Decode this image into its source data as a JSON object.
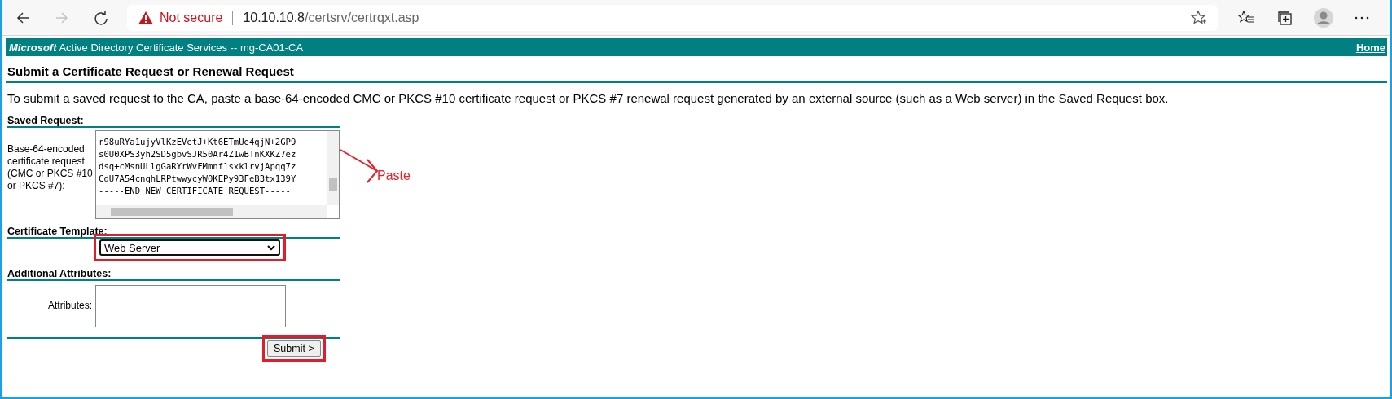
{
  "browser": {
    "security": "Not secure",
    "url_host": "10.10.10.8",
    "url_path": "/certsrv/certrqxt.asp",
    "forward_disabled": true
  },
  "banner": {
    "brand": "Microsoft",
    "title": "Active Directory Certificate Services  --  mg-CA01-CA",
    "home_link": "Home"
  },
  "heading": "Submit a Certificate Request or Renewal Request",
  "intro": "To submit a saved request to the CA, paste a base-64-encoded CMC or PKCS #10 certificate request or PKCS #7 renewal request generated by an external source (such as a Web server) in the Saved Request box.",
  "saved_request": {
    "section": "Saved Request:",
    "label": "Base-64-encoded certificate request (CMC or PKCS #10 or PKCS #7):",
    "lines": [
      "r98uRYa1ujyVlKzEVetJ+Kt6ETmUe4qjN+2GP9",
      "s0U0XPS3yh2SD5gbvSJR50Ar4Z1wBTnKXKZ7ez",
      "dsq+cMsnULlgGaRYrWvFMmnf1sxklrvjApqq7z",
      "CdU7A54cnqhLRPtwwycyW0KEPy93FeB3tx139Y",
      "-----END NEW CERTIFICATE REQUEST-----"
    ]
  },
  "annotation": {
    "text": "Paste"
  },
  "template": {
    "section": "Certificate Template:",
    "value": "Web Server"
  },
  "attributes": {
    "section": "Additional Attributes:",
    "label": "Attributes:"
  },
  "submit": "Submit >"
}
